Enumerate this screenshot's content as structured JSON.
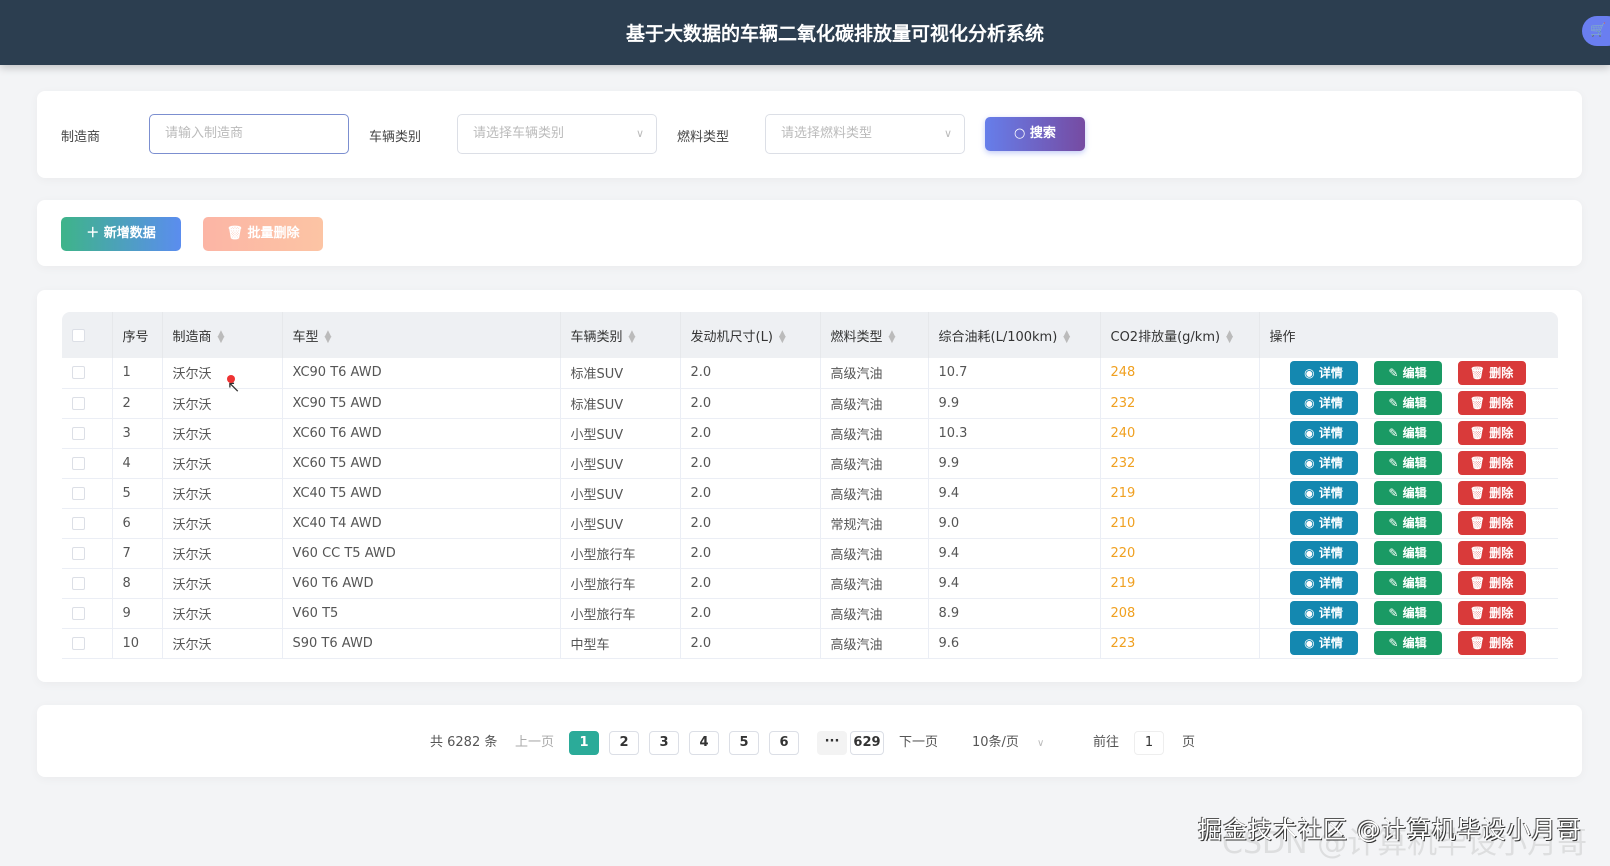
{
  "header": {
    "title": "基于大数据的车辆二氧化碳排放量可视化分析系统",
    "cart_icon": "cart-icon"
  },
  "search": {
    "manufacturer_label": "制造商",
    "manufacturer_placeholder": "请输入制造商",
    "class_label": "车辆类别",
    "class_placeholder": "请选择车辆类别",
    "fuel_label": "燃料类型",
    "fuel_placeholder": "请选择燃料类型",
    "search_button": "搜索"
  },
  "actions": {
    "add": "新增数据",
    "batch_delete": "批量删除"
  },
  "table": {
    "columns": [
      "序号",
      "制造商",
      "车型",
      "车辆类别",
      "发动机尺寸(L)",
      "燃料类型",
      "综合油耗(L/100km)",
      "CO2排放量(g/km)",
      "操作"
    ],
    "op_labels": {
      "view": "详情",
      "edit": "编辑",
      "delete": "删除"
    },
    "rows": [
      [
        "1",
        "沃尔沃",
        "XC90 T6 AWD",
        "标准SUV",
        "2.0",
        "高级汽油",
        "10.7",
        "248"
      ],
      [
        "2",
        "沃尔沃",
        "XC90 T5 AWD",
        "标准SUV",
        "2.0",
        "高级汽油",
        "9.9",
        "232"
      ],
      [
        "3",
        "沃尔沃",
        "XC60 T6 AWD",
        "小型SUV",
        "2.0",
        "高级汽油",
        "10.3",
        "240"
      ],
      [
        "4",
        "沃尔沃",
        "XC60 T5 AWD",
        "小型SUV",
        "2.0",
        "高级汽油",
        "9.9",
        "232"
      ],
      [
        "5",
        "沃尔沃",
        "XC40 T5 AWD",
        "小型SUV",
        "2.0",
        "高级汽油",
        "9.4",
        "219"
      ],
      [
        "6",
        "沃尔沃",
        "XC40 T4 AWD",
        "小型SUV",
        "2.0",
        "常规汽油",
        "9.0",
        "210"
      ],
      [
        "7",
        "沃尔沃",
        "V60 CC T5 AWD",
        "小型旅行车",
        "2.0",
        "高级汽油",
        "9.4",
        "220"
      ],
      [
        "8",
        "沃尔沃",
        "V60 T6 AWD",
        "小型旅行车",
        "2.0",
        "高级汽油",
        "9.4",
        "219"
      ],
      [
        "9",
        "沃尔沃",
        "V60 T5",
        "小型旅行车",
        "2.0",
        "高级汽油",
        "8.9",
        "208"
      ],
      [
        "10",
        "沃尔沃",
        "S90 T6 AWD",
        "中型车",
        "2.0",
        "高级汽油",
        "9.6",
        "223"
      ]
    ]
  },
  "pagination": {
    "total": "共 6282 条",
    "prev": "上一页",
    "pages": [
      "1",
      "2",
      "3",
      "4",
      "5",
      "6"
    ],
    "ellipsis": "···",
    "last": "629",
    "next": "下一页",
    "page_size": "10条/页",
    "goto_label": "前往",
    "goto_value": "1",
    "goto_suffix": "页",
    "current": 1
  },
  "watermark": {
    "text": "掘金技术社区 @计算机毕设小月哥",
    "text2": "CSDN @计算机毕设小月哥"
  }
}
